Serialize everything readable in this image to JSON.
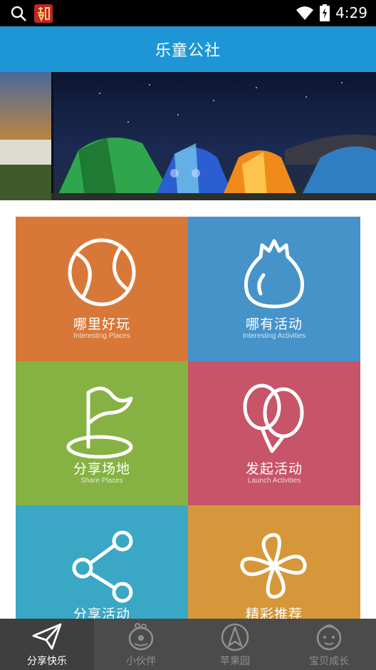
{
  "status_bar": {
    "time": "4:29"
  },
  "app_bar": {
    "title": "乐童公社"
  },
  "tiles": [
    {
      "zh": "哪里好玩",
      "en": "Interesting Places",
      "color": "#d87838"
    },
    {
      "zh": "哪有活动",
      "en": "Interesting Activities",
      "color": "#4593c8"
    },
    {
      "zh": "分享场地",
      "en": "Share Places",
      "color": "#86b243"
    },
    {
      "zh": "发起活动",
      "en": "Launch Activities",
      "color": "#c75468"
    },
    {
      "zh": "分享活动",
      "color": "#3aa7c4"
    },
    {
      "zh": "精彩推荐",
      "color": "#d5973a"
    }
  ],
  "tabs": [
    {
      "label": "分享快乐",
      "active": true
    },
    {
      "label": "小伙伴",
      "active": false
    },
    {
      "label": "苹果园",
      "active": false
    },
    {
      "label": "宝贝成长",
      "active": false
    }
  ],
  "colors": {
    "app_bar": "#1e96d6",
    "tab_bar": "#4b4b4b",
    "status_bar": "#000000"
  }
}
